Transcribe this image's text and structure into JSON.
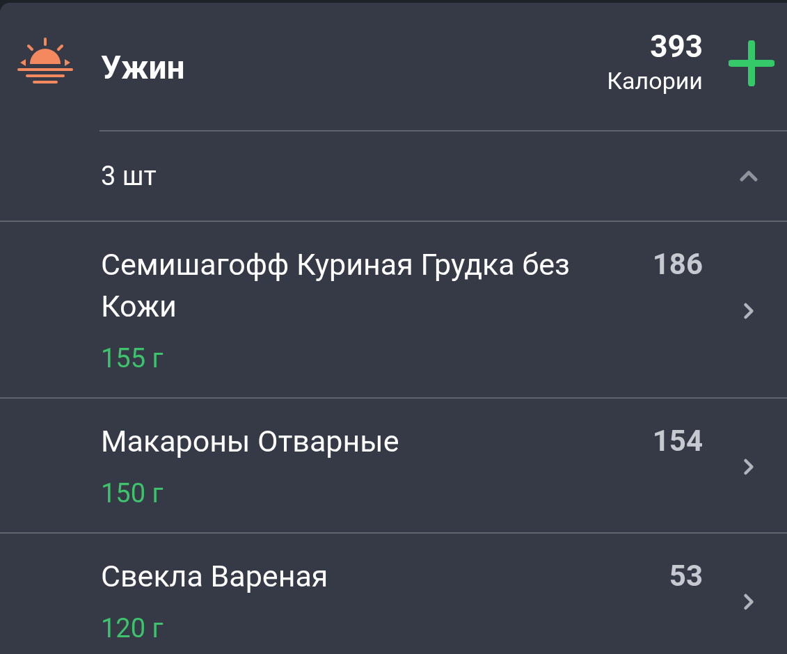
{
  "meal": {
    "title": "Ужин",
    "calories": "393",
    "calories_label": "Калории"
  },
  "summary": {
    "count": "3 шт",
    "expanded": true
  },
  "items": [
    {
      "name": "Семишагофф Куриная Грудка без Кожи",
      "calories": "186",
      "amount": "155 г"
    },
    {
      "name": "Макароны Отварные",
      "calories": "154",
      "amount": "150 г"
    },
    {
      "name": "Свекла Вареная",
      "calories": "53",
      "amount": "120 г"
    }
  ]
}
